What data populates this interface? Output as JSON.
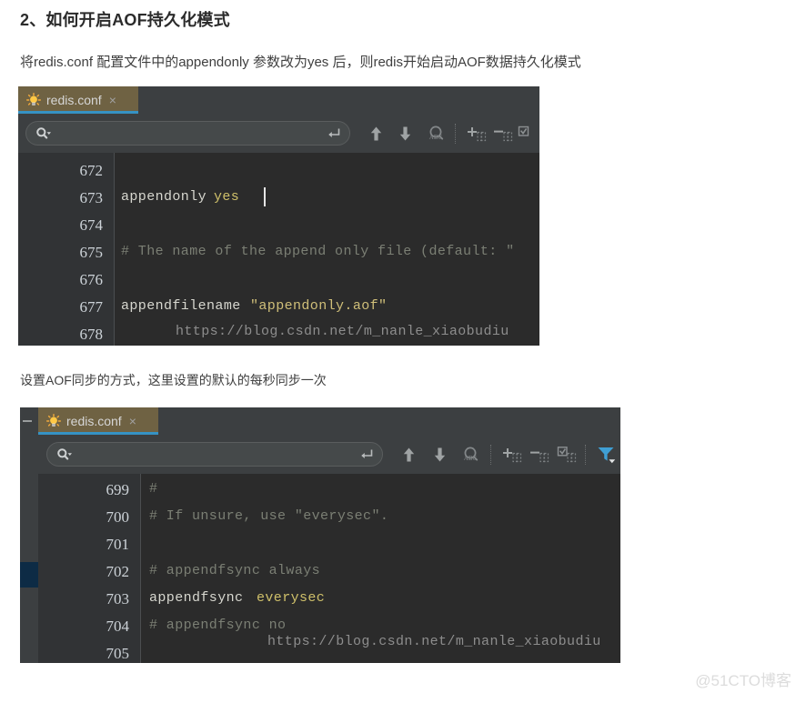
{
  "article": {
    "heading": "2、如何开启AOF持久化模式",
    "paragraph_1": "将redis.conf 配置文件中的appendonly 参数改为yes 后，则redis开始启动AOF数据持久化模式",
    "paragraph_2": "设置AOF同步的方式，这里设置的默认的每秒同步一次"
  },
  "colors": {
    "page_background": "#ffffff",
    "ide_chrome": "#3c3f41",
    "editor_background": "#2b2b2b",
    "gutter_background": "#313335",
    "tab_active_background": "#6f6243",
    "tab_underline": "#3592c4",
    "comment": "#7b7f74",
    "string": "#d0bf79",
    "plain_text": "#d7d7cf",
    "filter_icon": "#3f9fd4",
    "bookmark_marker": "#0d2b45"
  },
  "panel_1": {
    "tab": {
      "label": "redis.conf",
      "close_label": "×",
      "icon": "conf-file-icon"
    },
    "toolbar": {
      "search_value": "",
      "search_placeholder": "",
      "icons": [
        "search-dropdown-icon",
        "enter-return-icon",
        "arrow-up-icon",
        "arrow-down-icon",
        "match-case-abc-icon",
        "add-column-icon",
        "remove-column-icon",
        "select-columns-icon"
      ]
    },
    "editor": {
      "line_numbers": [
        "672",
        "673",
        "674",
        "675",
        "676",
        "677",
        "678"
      ],
      "lines": [
        {
          "number": "672",
          "segments": []
        },
        {
          "number": "673",
          "segments": [
            {
              "text": "appendonly ",
              "kind": "plain"
            },
            {
              "text": "yes",
              "kind": "value"
            }
          ],
          "caret": true
        },
        {
          "number": "674",
          "segments": []
        },
        {
          "number": "675",
          "segments": [
            {
              "text": "# The name of the append only file (default: \"",
              "kind": "comment"
            }
          ]
        },
        {
          "number": "676",
          "segments": []
        },
        {
          "number": "677",
          "segments": [
            {
              "text": "appendfilename ",
              "kind": "plain"
            },
            {
              "text": "\"appendonly.aof\"",
              "kind": "string"
            }
          ]
        },
        {
          "number": "678",
          "segments": []
        }
      ],
      "watermark_url": "https://blog.csdn.net/m_nanle_xiaobudiu"
    }
  },
  "panel_2": {
    "tab": {
      "label": "redis.conf",
      "close_label": "×",
      "icon": "conf-file-icon"
    },
    "toolbar": {
      "search_value": "",
      "search_placeholder": "",
      "icons": [
        "search-dropdown-icon",
        "enter-return-icon",
        "arrow-up-icon",
        "arrow-down-icon",
        "match-case-abc-icon",
        "add-column-icon",
        "remove-column-icon",
        "select-columns-icon",
        "filter-funnel-icon"
      ]
    },
    "editor": {
      "line_numbers": [
        "699",
        "700",
        "701",
        "702",
        "703",
        "704",
        "705"
      ],
      "lines": [
        {
          "number": "699",
          "segments": [
            {
              "text": "#",
              "kind": "comment"
            }
          ]
        },
        {
          "number": "700",
          "segments": [
            {
              "text": "# If unsure, use \"everysec\".",
              "kind": "comment"
            }
          ]
        },
        {
          "number": "701",
          "segments": []
        },
        {
          "number": "702",
          "segments": [
            {
              "text": "# appendfsync always",
              "kind": "comment"
            }
          ]
        },
        {
          "number": "703",
          "segments": [
            {
              "text": "appendfsync ",
              "kind": "plain"
            },
            {
              "text": "everysec",
              "kind": "value"
            }
          ]
        },
        {
          "number": "704",
          "segments": [
            {
              "text": "# appendfsync no",
              "kind": "comment"
            }
          ]
        },
        {
          "number": "705",
          "segments": []
        }
      ],
      "watermark_url": "https://blog.csdn.net/m_nanle_xiaobudiu"
    }
  },
  "watermark": {
    "corner_text": "@51CTO博客"
  }
}
